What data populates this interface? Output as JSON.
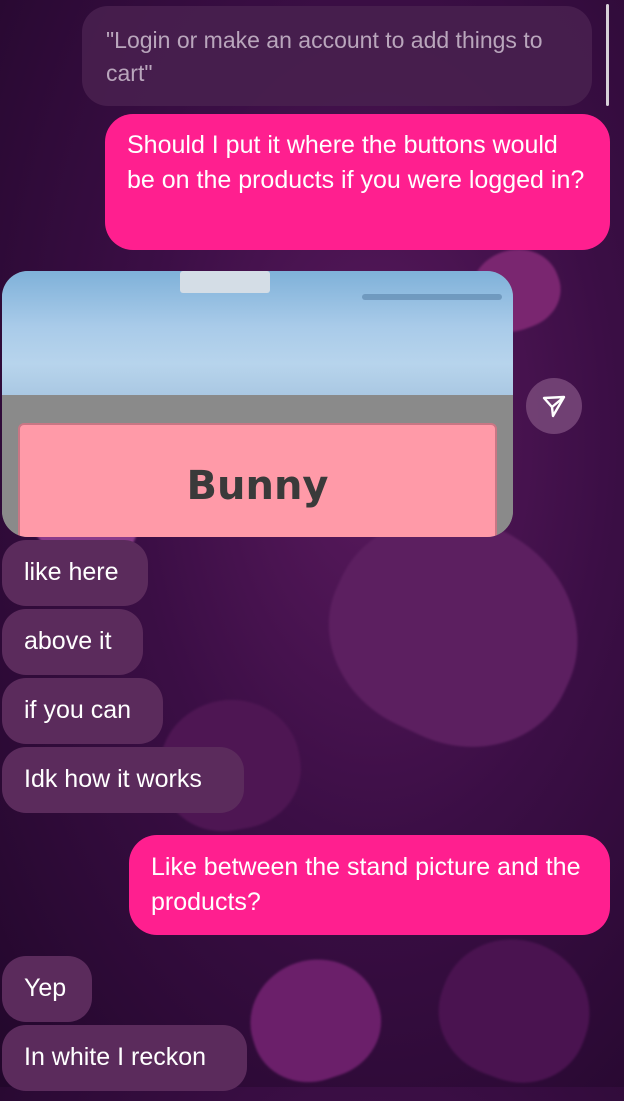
{
  "messages": [
    {
      "kind": "quote",
      "text": "\"Login or make an account to add things to cart\""
    },
    {
      "kind": "sent",
      "text": "Should I put it where the buttons would be on the products if you were logged in?"
    },
    {
      "kind": "received-image",
      "image_text": "Bunny",
      "icon": "send-icon"
    },
    {
      "kind": "received",
      "text": "like here"
    },
    {
      "kind": "received",
      "text": "above it"
    },
    {
      "kind": "received",
      "text": "if you can"
    },
    {
      "kind": "received",
      "text": "Idk how it works"
    },
    {
      "kind": "sent",
      "text": "Like between the stand picture and the products?"
    },
    {
      "kind": "received",
      "text": "Yep"
    },
    {
      "kind": "received",
      "text": "In white I reckon"
    }
  ],
  "colors": {
    "sent_bubble": "#ff1f8f",
    "received_bubble": "#5b2b5c",
    "quote_bubble": "#48204e",
    "background": "#3b0e45"
  }
}
